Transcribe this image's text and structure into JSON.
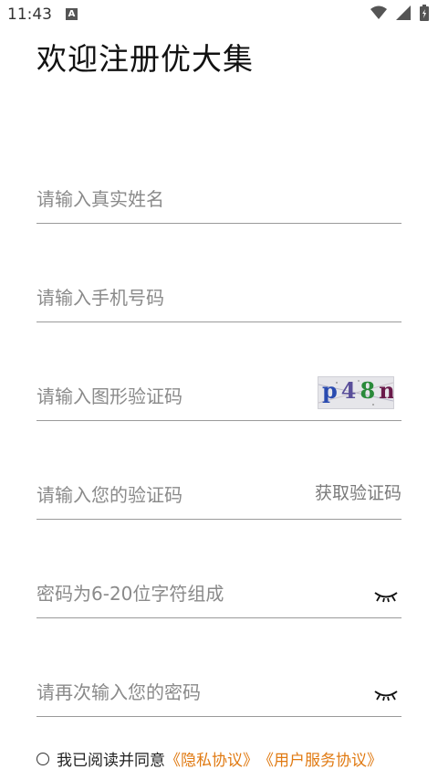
{
  "status_bar": {
    "time": "11:43",
    "notification_icon": "A"
  },
  "title": "欢迎注册优大集",
  "fields": {
    "name": {
      "placeholder": "请输入真实姓名",
      "value": ""
    },
    "phone": {
      "placeholder": "请输入手机号码",
      "value": ""
    },
    "graphic_code": {
      "placeholder": "请输入图形验证码",
      "value": "",
      "captcha_text": "p48n"
    },
    "sms_code": {
      "placeholder": "请输入您的验证码",
      "value": "",
      "action_label": "获取验证码"
    },
    "password": {
      "placeholder": "密码为6-20位字符组成",
      "value": ""
    },
    "confirm_password": {
      "placeholder": "请再次输入您的密码",
      "value": ""
    }
  },
  "agreement": {
    "text": "我已阅读并同意",
    "privacy_link": "《隐私协议》",
    "terms_link": "《用户服务协议》"
  },
  "colors": {
    "link": "#e07a12",
    "divider": "#9a9a9a",
    "placeholder": "#8a8a8a"
  }
}
